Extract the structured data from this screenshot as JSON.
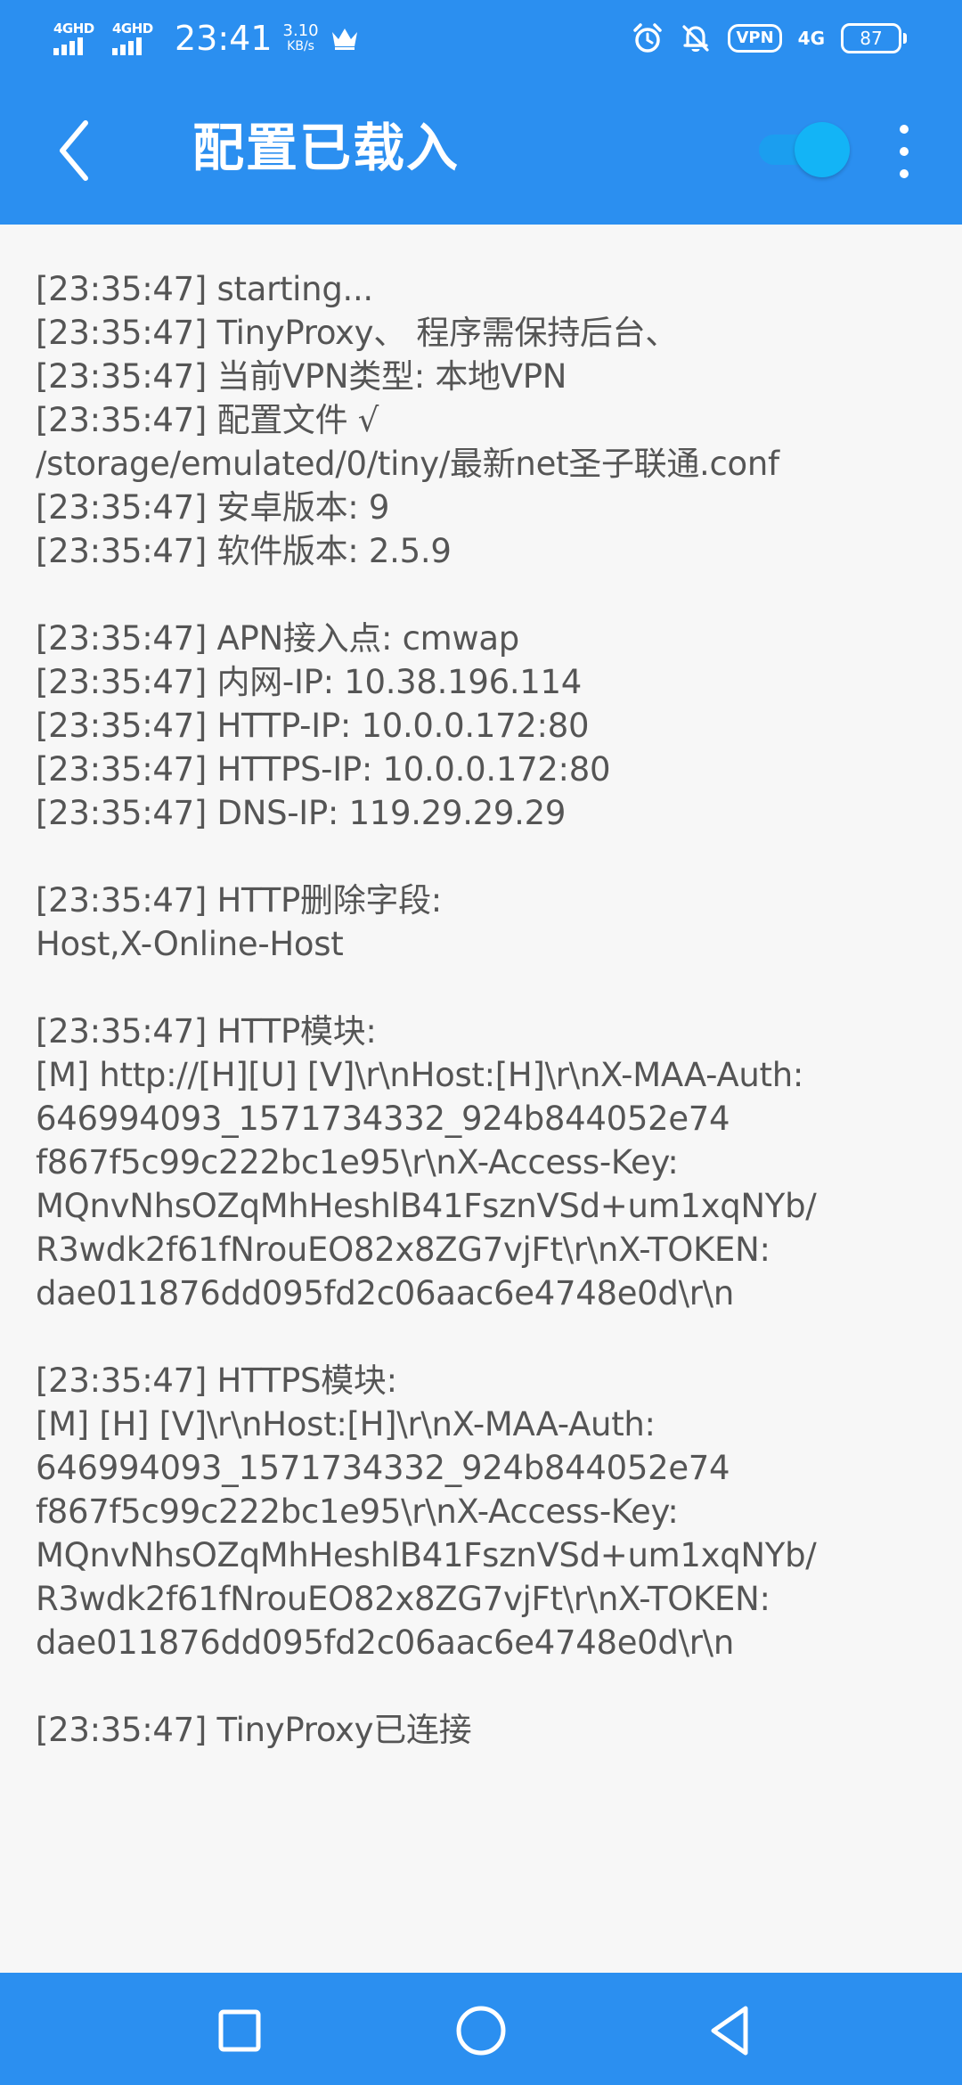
{
  "status_bar": {
    "network_1": "4GHD",
    "network_2": "4GHD",
    "time": "23:41",
    "speed_value": "3.10",
    "speed_unit": "KB/s",
    "vpn": "VPN",
    "net_type": "4G",
    "battery": "87",
    "icons": [
      "crown-icon",
      "alarm-icon",
      "bell-off-icon"
    ]
  },
  "app_bar": {
    "title": "配置已载入",
    "toggle_on": true
  },
  "log": {
    "lines": [
      "[23:35:47] starting...",
      "[23:35:47] TinyProxy、 程序需保持后台、",
      "[23:35:47] 当前VPN类型: 本地VPN",
      "[23:35:47] 配置文件 √",
      "/storage/emulated/0/tiny/最新net圣子联通.conf",
      "[23:35:47] 安卓版本: 9",
      "[23:35:47] 软件版本: 2.5.9",
      "",
      "[23:35:47] APN接入点: cmwap",
      "[23:35:47] 内网-IP: 10.38.196.114",
      "[23:35:47] HTTP-IP: 10.0.0.172:80",
      "[23:35:47] HTTPS-IP: 10.0.0.172:80",
      "[23:35:47] DNS-IP: 119.29.29.29",
      "",
      "[23:35:47] HTTP删除字段:",
      "Host,X-Online-Host",
      "",
      "[23:35:47] HTTP模块:",
      "[M] http://[H][U] [V]\\r\\nHost:[H]\\r\\nX-MAA-Auth:",
      "646994093_1571734332_924b844052e74",
      "f867f5c99c222bc1e95\\r\\nX-Access-Key:",
      "MQnvNhsOZqMhHeshlB41FsznVSd+um1xqNYb/",
      "R3wdk2f61fNrouEO82x8ZG7vjFt\\r\\nX-TOKEN:",
      "dae011876dd095fd2c06aac6e4748e0d\\r\\n",
      "",
      "[23:35:47] HTTPS模块:",
      "[M] [H] [V]\\r\\nHost:[H]\\r\\nX-MAA-Auth:",
      "646994093_1571734332_924b844052e74",
      "f867f5c99c222bc1e95\\r\\nX-Access-Key:",
      "MQnvNhsOZqMhHeshlB41FsznVSd+um1xqNYb/",
      "R3wdk2f61fNrouEO82x8ZG7vjFt\\r\\nX-TOKEN:",
      "dae011876dd095fd2c06aac6e4748e0d\\r\\n",
      "",
      "[23:35:47] TinyProxy已连接"
    ]
  },
  "nav_bar": {
    "buttons": [
      "recents-square-icon",
      "home-circle-icon",
      "back-triangle-icon"
    ]
  },
  "colors": {
    "primary": "#2b8ff0",
    "toggle": "#13b4f6",
    "background": "#f7f7f7",
    "text": "#555555"
  }
}
